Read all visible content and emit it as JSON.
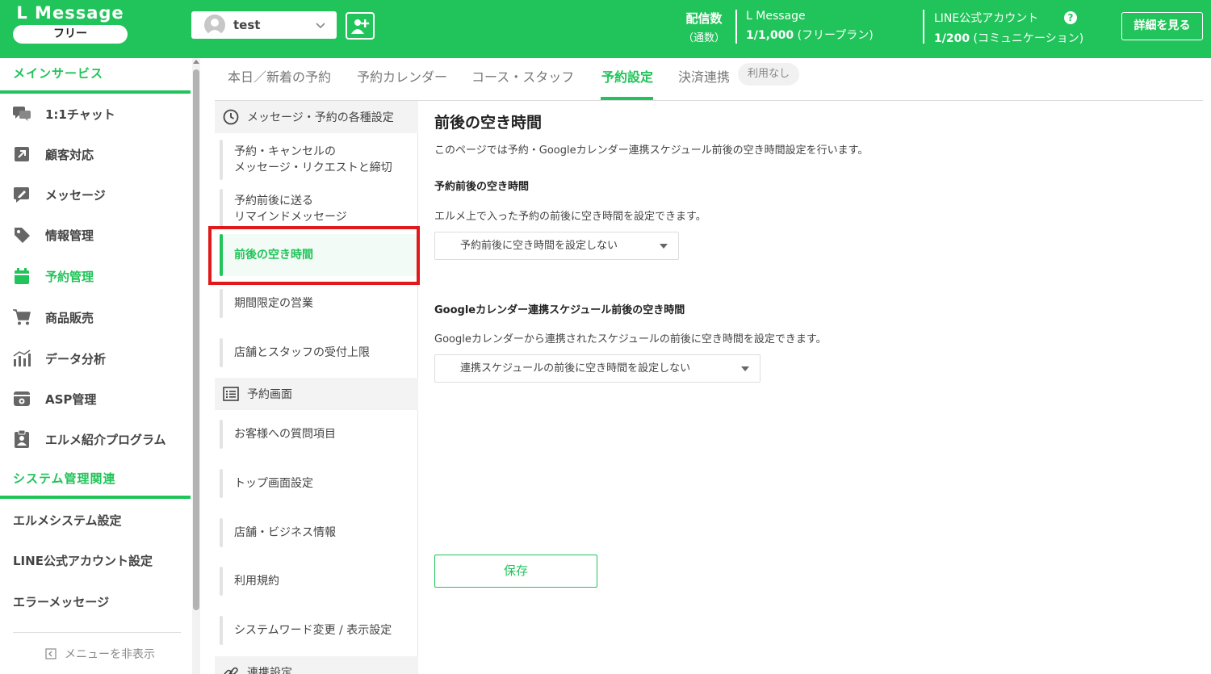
{
  "header": {
    "brand": "L Message",
    "plan": "フリー",
    "account_name": "test",
    "delivery_label": "配信数",
    "delivery_sub": "（通数）",
    "lm_title": "L Message",
    "lm_count": "1/1,000",
    "lm_plan": "(フリープラン)",
    "line_title": "LINE公式アカウント",
    "line_count": "1/200",
    "line_plan": "(コミュニケーション)",
    "help": "?",
    "detail_button": "詳細を見る"
  },
  "sidebar": {
    "section_main": "メインサービス",
    "items": [
      {
        "label": "1:1チャット",
        "icon": "chat-icon"
      },
      {
        "label": "顧客対応",
        "icon": "arrow-up-right-icon"
      },
      {
        "label": "メッセージ",
        "icon": "message-edit-icon"
      },
      {
        "label": "情報管理",
        "icon": "tag-icon"
      },
      {
        "label": "予約管理",
        "icon": "calendar-icon"
      },
      {
        "label": "商品販売",
        "icon": "cart-icon"
      },
      {
        "label": "データ分析",
        "icon": "chart-icon"
      },
      {
        "label": "ASP管理",
        "icon": "asp-icon"
      },
      {
        "label": "エルメ紹介プログラム",
        "icon": "clipboard-user-icon"
      }
    ],
    "section_system": "システム管理関連",
    "system_items": [
      "エルメシステム設定",
      "LINE公式アカウント設定",
      "エラーメッセージ"
    ],
    "hide_menu": "メニューを非表示"
  },
  "tabs": {
    "items": [
      "本日／新着の予約",
      "予約カレンダー",
      "コース・スタッフ",
      "予約設定",
      "決済連携"
    ],
    "badge": "利用なし"
  },
  "submenu": {
    "head1": "メッセージ・予約の各種設定",
    "group1": [
      [
        "予約・キャンセルの",
        "メッセージ・リクエストと締切"
      ],
      [
        "予約前後に送る",
        "リマインドメッセージ"
      ],
      [
        "前後の空き時間"
      ],
      [
        "期間限定の営業"
      ],
      [
        "店舗とスタッフの受付上限"
      ]
    ],
    "head2": "予約画面",
    "group2": [
      "お客様への質問項目",
      "トップ画面設定",
      "店舗・ビジネス情報",
      "利用規約",
      "システムワード変更 / 表示設定"
    ],
    "head3": "連携設定"
  },
  "main": {
    "title": "前後の空き時間",
    "description": "このページでは予約・Googleカレンダー連携スケジュール前後の空き時間設定を行います。",
    "section1_title": "予約前後の空き時間",
    "section1_desc": "エルメ上で入った予約の前後に空き時間を設定できます。",
    "section1_select": "予約前後に空き時間を設定しない",
    "section2_title": "Googleカレンダー連携スケジュール前後の空き時間",
    "section2_desc": "Googleカレンダーから連携されたスケジュールの前後に空き時間を設定できます。",
    "section2_select": "連携スケジュールの前後に空き時間を設定しない",
    "save": "保存"
  },
  "colors": {
    "brand_green": "#21c45a",
    "highlight_red": "#e01a1a"
  }
}
